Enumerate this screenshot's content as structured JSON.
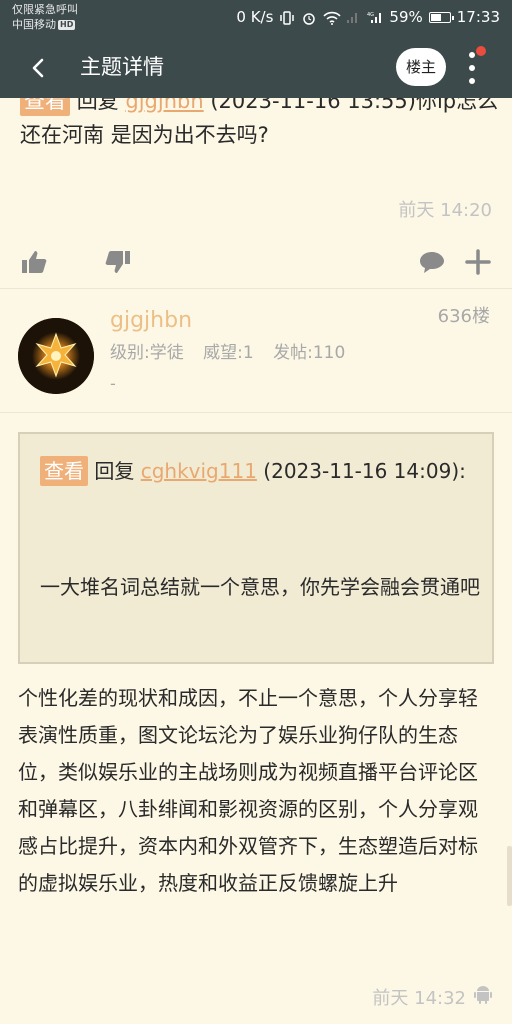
{
  "status_bar": {
    "line1": "仅限紧急呼叫",
    "carrier": "中国移动",
    "hd": "HD",
    "net_speed": "0 K/s",
    "battery": "59%",
    "battery_level": 0.59,
    "time": "17:33"
  },
  "app_bar": {
    "title": "主题详情",
    "louzhu_label": "楼主"
  },
  "prev_post": {
    "tag": "查看",
    "reply_word": "回复",
    "user": "gjgjhbn",
    "rest": " (2023-11-16 13:55)你ip怎么还在河南 是因为出不去吗?",
    "time": "前天 14:20"
  },
  "post": {
    "username": "gjgjhbn",
    "floor": "636楼",
    "level": "级别:学徒",
    "prestige": "威望:1",
    "posts": "发帖:110",
    "dash": "-",
    "quote": {
      "tag": "查看",
      "reply_word": "回复",
      "user": "cghkvig111",
      "date": " (2023-11-16 14:09):",
      "text": "一大堆名词总结就一个意思，你先学会融会贯通吧"
    },
    "body": "个性化差的现状和成因，不止一个意思，个人分享轻表演性质重，图文论坛沦为了娱乐业狗仔队的生态位，类似娱乐业的主战场则成为视频直播平台评论区和弹幕区，八卦绯闻和影视资源的区别，个人分享观感占比提升，资本内和外双管齐下，生态塑造后对标的虚拟娱乐业，热度和收益正反馈螺旋上升",
    "time": "前天 14:32"
  },
  "colors": {
    "bar": "#3d4a4b",
    "page_bg": "#fdf8e6",
    "accent": "#f0b07a",
    "username": "#ecbf87"
  }
}
